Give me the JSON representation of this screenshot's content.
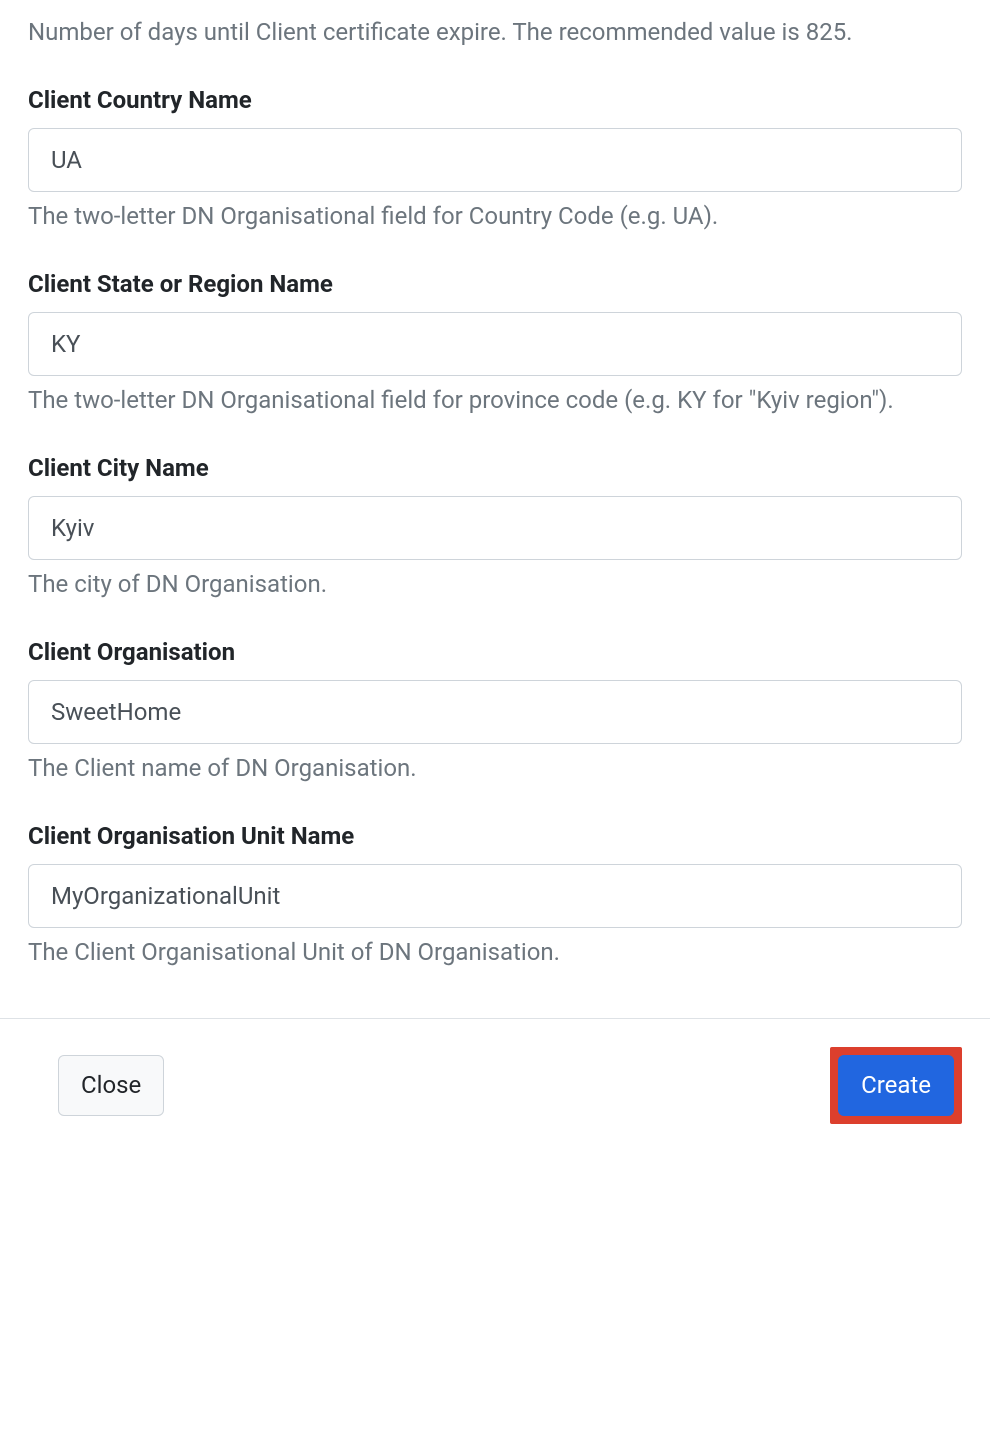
{
  "intro_help": "Number of days until Client certificate expire. The recommended value is 825.",
  "fields": {
    "country": {
      "label": "Client Country Name",
      "value": "UA",
      "help": "The two-letter DN Organisational field for Country Code (e.g. UA)."
    },
    "state": {
      "label": "Client State or Region Name",
      "value": "KY",
      "help": "The two-letter DN Organisational field for province code (e.g. KY for \"Kyiv region\")."
    },
    "city": {
      "label": "Client City Name",
      "value": "Kyiv",
      "help": "The city of DN Organisation."
    },
    "org": {
      "label": "Client Organisation",
      "value": "SweetHome",
      "help": "The Client name of DN Organisation."
    },
    "org_unit": {
      "label": "Client Organisation Unit Name",
      "value": "MyOrganizationalUnit",
      "help": "The Client Organisational Unit of DN Organisation."
    }
  },
  "footer": {
    "close_label": "Close",
    "create_label": "Create"
  }
}
